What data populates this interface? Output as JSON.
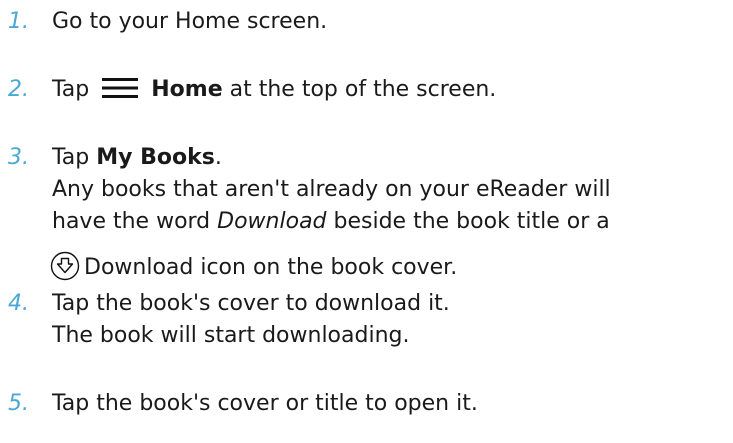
{
  "steps": [
    {
      "number": "1.",
      "text": "Go to your Home screen."
    },
    {
      "number": "2.",
      "before": "Tap",
      "bold": "Home",
      "after": "at the top of the screen.",
      "icon": "menu-icon"
    },
    {
      "number": "3.",
      "before": "Tap",
      "bold": "My Books",
      "after": ".",
      "line2": "Any books that aren't already on your eReader will",
      "line3_before": "have the word",
      "line3_italic": "Download",
      "line3_after": "beside the book title or a",
      "line4": "Download icon on the book cover.",
      "icon": "download-icon"
    },
    {
      "number": "4.",
      "line1": "Tap the book's cover to download it.",
      "line2": "The book will start downloading."
    },
    {
      "number": "5.",
      "text": "Tap the book's cover or title to open it."
    }
  ],
  "colors": {
    "number": "#4aa8d6",
    "text": "#1a1a1a",
    "icon": "#111111"
  }
}
